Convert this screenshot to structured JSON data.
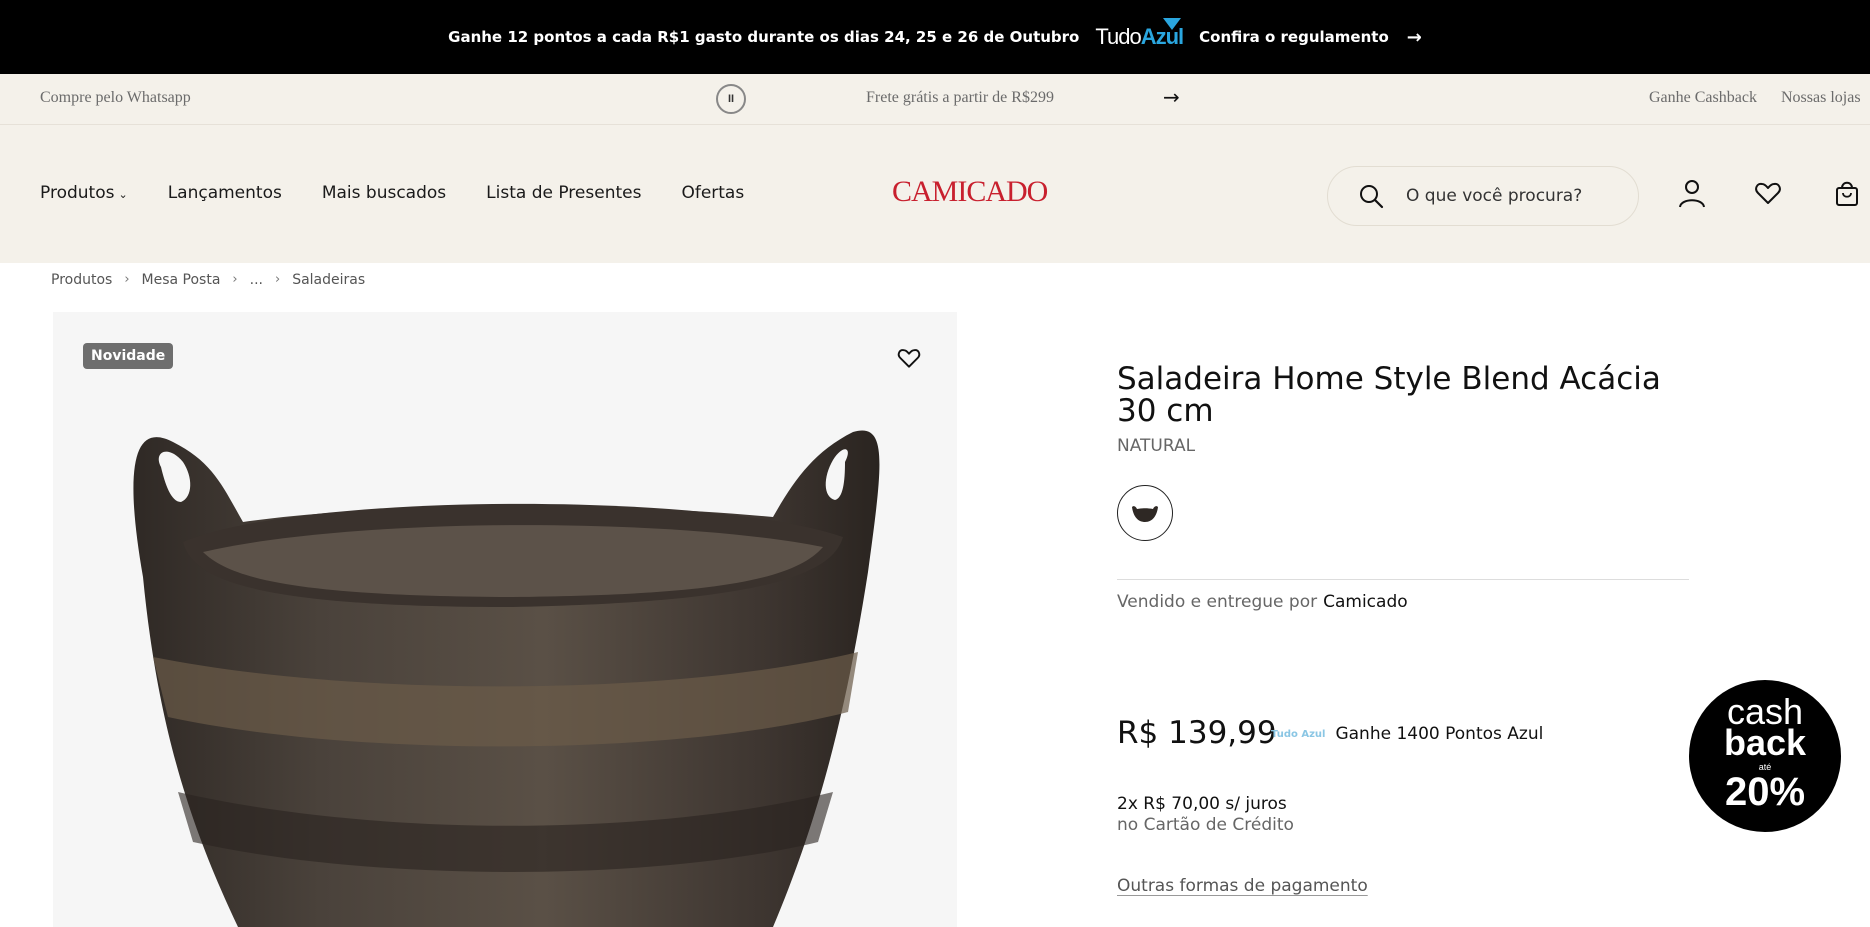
{
  "promo": {
    "text": "Ganhe 12 pontos a cada R$1 gasto durante os dias 24, 25 e 26 de Outubro",
    "brand_prefix": "Tudo",
    "brand_suffix": "Azul",
    "link": "Confira o regulamento",
    "arrow_icon": "arrow-right-icon"
  },
  "infobar": {
    "whatsapp": "Compre pelo Whatsapp",
    "pause_icon": "pause-icon",
    "message": "Frete grátis a partir de R$299",
    "next_icon": "arrow-right-icon",
    "cashback": "Ganhe Cashback",
    "stores": "Nossas lojas"
  },
  "header": {
    "nav": [
      "Produtos",
      "Lançamentos",
      "Mais buscados",
      "Lista de Presentes",
      "Ofertas"
    ],
    "logo": "CAMICADO",
    "search_placeholder": "O que você procura?",
    "icons": [
      "search-icon",
      "user-icon",
      "heart-icon",
      "bag-icon"
    ]
  },
  "breadcrumb": [
    "Produtos",
    "Mesa Posta",
    "...",
    "Saladeiras"
  ],
  "product": {
    "badge": "Novidade",
    "title": "Saladeira Home Style Blend Acácia 30 cm",
    "color": "NATURAL",
    "seller_label": "Vendido e entregue por",
    "seller": "Camicado",
    "price": "R$ 139,99",
    "points": "Ganhe 1400 Pontos Azul",
    "installments": "2x R$ 70,00 s/ juros",
    "installments_note": "no Cartão de Crédito",
    "other_payments": "Outras formas de pagamento"
  },
  "cashback_badge": {
    "line1": "cash",
    "line2": "back",
    "line3": "até",
    "line4": "20%"
  },
  "colors": {
    "promo_bg": "#000000",
    "header_bg": "#f4f1ea",
    "brand_red": "#c8202e",
    "tudoazul_blue": "#2aa6df"
  }
}
